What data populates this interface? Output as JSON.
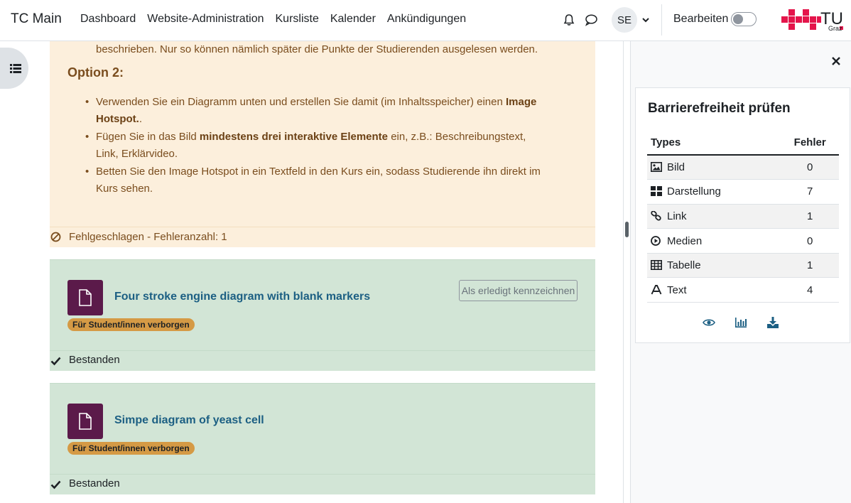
{
  "navbar": {
    "brand": "TC Main",
    "links": [
      "Dashboard",
      "Website-Administration",
      "Kursliste",
      "Kalender",
      "Ankündigungen"
    ],
    "avatar_initials": "SE",
    "edit_label": "Bearbeiten",
    "edit_mode": false,
    "logo_text": "TU",
    "logo_subtext": "Graz"
  },
  "card_option": {
    "intro_text": "beschrieben. Nur so können nämlich später die Punkte der Studierenden ausgelesen werden.",
    "heading": "Option 2:",
    "bullets": [
      {
        "pre": "Verwenden Sie ein Diagramm unten und erstellen Sie damit (im Inhaltsspeicher) einen ",
        "bold": "Image Hotspot.",
        "post": "."
      },
      {
        "pre": "Fügen Sie in das Bild ",
        "bold": "mindestens drei interaktive Elemente",
        "post": " ein, z.B.: Beschreibungstext, Link, Erklärvideo."
      },
      {
        "pre": "Betten Sie den Image Hotspot in ein Textfeld in den Kurs ein, sodass Studierende ihn direkt im Kurs sehen.",
        "bold": "",
        "post": ""
      }
    ],
    "status_text": "Fehlgeschlagen - Fehleranzahl: 1"
  },
  "activities": [
    {
      "title": "Four stroke engine diagram with blank markers",
      "badge": "Für Student/innen verborgen",
      "button": "Als erledigt kennzeichnen",
      "status_text": "Bestanden"
    },
    {
      "title": "Simpe diagram of yeast cell",
      "badge": "Für Student/innen verborgen",
      "status_text": "Bestanden"
    }
  ],
  "accessibility_panel": {
    "title": "Barrierefreiheit prüfen",
    "col_types": "Types",
    "col_errors": "Fehler",
    "rows": [
      {
        "icon": "image-icon",
        "type": "Bild",
        "errors": "0"
      },
      {
        "icon": "layout-grid-icon",
        "type": "Darstellung",
        "errors": "7"
      },
      {
        "icon": "link-icon",
        "type": "Link",
        "errors": "1"
      },
      {
        "icon": "play-circle-icon",
        "type": "Medien",
        "errors": "0"
      },
      {
        "icon": "table-icon",
        "type": "Tabelle",
        "errors": "1"
      },
      {
        "icon": "font-icon",
        "type": "Text",
        "errors": "4"
      }
    ],
    "actions": [
      "eye-icon",
      "bar-chart-icon",
      "download-icon"
    ]
  },
  "colors": {
    "failed_bg": "#fcefdc",
    "passed_bg": "#d2e5d6",
    "link_blue": "#1c5f83",
    "activity_icon_bg": "#5b1a4a",
    "badge_bg": "#d59a45",
    "logo_red": "#e4154b"
  }
}
